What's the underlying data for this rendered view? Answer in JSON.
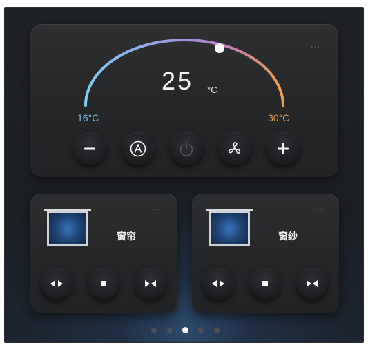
{
  "thermostat": {
    "setpoint": "25",
    "unit": "°C",
    "min_label": "16°C",
    "max_label": "30°C",
    "min_color": "#7ec1ea",
    "max_color": "#e59a4a",
    "level": 0.64,
    "more": "···",
    "buttons": [
      {
        "name": "decrease-button",
        "icon": "minus-icon"
      },
      {
        "name": "auto-mode-button",
        "icon": "auto-a-icon"
      },
      {
        "name": "power-button",
        "icon": "power-icon"
      },
      {
        "name": "fan-speed-button",
        "icon": "fan-icon"
      },
      {
        "name": "increase-button",
        "icon": "plus-icon"
      }
    ]
  },
  "curtain": {
    "title": "窗帘",
    "more": "···",
    "buttons": [
      {
        "name": "open-button",
        "icon": "open-arrows-icon"
      },
      {
        "name": "stop-button",
        "icon": "stop-icon"
      },
      {
        "name": "close-button",
        "icon": "close-arrows-icon"
      }
    ]
  },
  "sheer": {
    "title": "窗纱",
    "more": "···",
    "buttons": [
      {
        "name": "open-button",
        "icon": "open-arrows-icon"
      },
      {
        "name": "stop-button",
        "icon": "stop-icon"
      },
      {
        "name": "close-button",
        "icon": "close-arrows-icon"
      }
    ]
  },
  "pager": {
    "count": 5,
    "active_index": 2
  }
}
